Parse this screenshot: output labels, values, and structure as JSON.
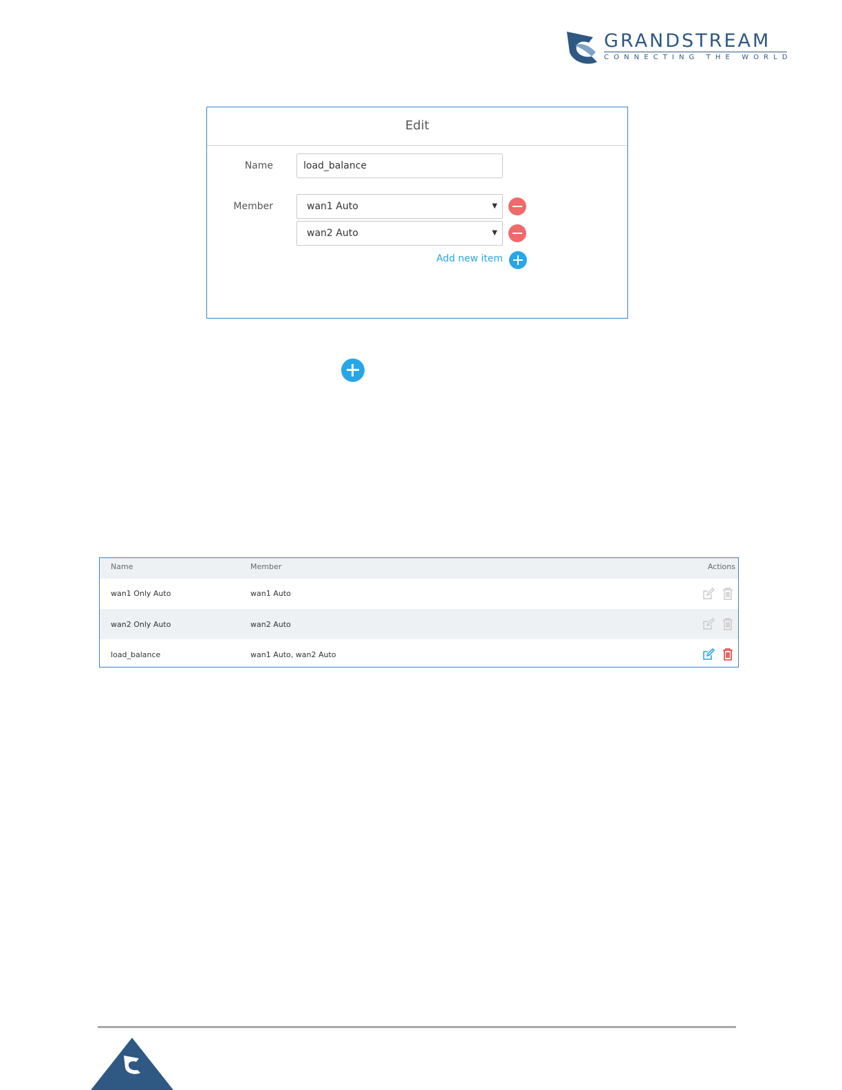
{
  "brand": {
    "name": "GRANDSTREAM",
    "tagline": "CONNECTING THE WORLD",
    "color": "#2f5883"
  },
  "edit_dialog": {
    "title": "Edit",
    "name_label": "Name",
    "name_value": "load_balance",
    "member_label": "Member",
    "members": [
      "wan1 Auto",
      "wan2 Auto"
    ],
    "add_new_item_label": "Add new item"
  },
  "table": {
    "headers": {
      "name": "Name",
      "member": "Member",
      "actions": "Actions"
    },
    "rows": [
      {
        "name": "wan1 Only Auto",
        "member": "wan1 Auto",
        "actions_enabled": false
      },
      {
        "name": "wan2 Only Auto",
        "member": "wan2 Auto",
        "actions_enabled": false
      },
      {
        "name": "load_balance",
        "member": "wan1 Auto, wan2 Auto",
        "actions_enabled": true
      }
    ]
  },
  "colors": {
    "accent": "#27a6e8",
    "remove": "#ef6a6a",
    "border": "#3a7fc7",
    "disabled_icon": "#c8c8c8",
    "delete_active": "#e53e3e"
  },
  "icons": [
    "grandstream-logo-icon",
    "minus-circle-icon",
    "plus-circle-icon",
    "edit-icon",
    "trash-icon"
  ]
}
